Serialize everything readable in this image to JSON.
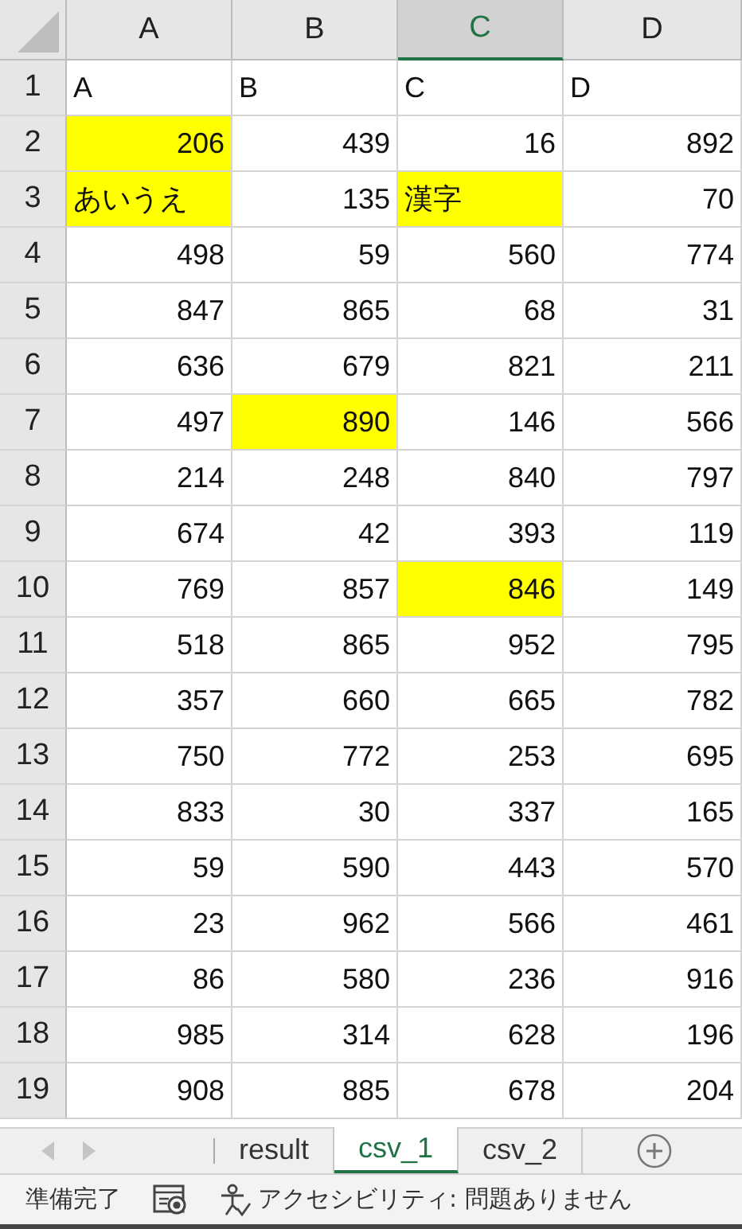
{
  "columns": [
    {
      "label": "A",
      "selected": false
    },
    {
      "label": "B",
      "selected": false
    },
    {
      "label": "C",
      "selected": true
    },
    {
      "label": "D",
      "selected": false
    }
  ],
  "rows": [
    {
      "header": "1",
      "cells": [
        {
          "kind": "text",
          "text": "A",
          "highlighted": false
        },
        {
          "kind": "text",
          "text": "B",
          "highlighted": false
        },
        {
          "kind": "text",
          "text": "C",
          "highlighted": false
        },
        {
          "kind": "text",
          "text": "D",
          "highlighted": false
        }
      ]
    },
    {
      "header": "2",
      "cells": [
        {
          "kind": "number",
          "text": "206",
          "highlighted": true
        },
        {
          "kind": "number",
          "text": "439",
          "highlighted": false
        },
        {
          "kind": "number",
          "text": "16",
          "highlighted": false
        },
        {
          "kind": "number",
          "text": "892",
          "highlighted": false
        }
      ]
    },
    {
      "header": "3",
      "cells": [
        {
          "kind": "text",
          "text": "あいうえ",
          "highlighted": true
        },
        {
          "kind": "number",
          "text": "135",
          "highlighted": false
        },
        {
          "kind": "text",
          "text": "漢字",
          "highlighted": true
        },
        {
          "kind": "number",
          "text": "70",
          "highlighted": false
        }
      ]
    },
    {
      "header": "4",
      "cells": [
        {
          "kind": "number",
          "text": "498",
          "highlighted": false
        },
        {
          "kind": "number",
          "text": "59",
          "highlighted": false
        },
        {
          "kind": "number",
          "text": "560",
          "highlighted": false
        },
        {
          "kind": "number",
          "text": "774",
          "highlighted": false
        }
      ]
    },
    {
      "header": "5",
      "cells": [
        {
          "kind": "number",
          "text": "847",
          "highlighted": false
        },
        {
          "kind": "number",
          "text": "865",
          "highlighted": false
        },
        {
          "kind": "number",
          "text": "68",
          "highlighted": false
        },
        {
          "kind": "number",
          "text": "31",
          "highlighted": false
        }
      ]
    },
    {
      "header": "6",
      "cells": [
        {
          "kind": "number",
          "text": "636",
          "highlighted": false
        },
        {
          "kind": "number",
          "text": "679",
          "highlighted": false
        },
        {
          "kind": "number",
          "text": "821",
          "highlighted": false
        },
        {
          "kind": "number",
          "text": "211",
          "highlighted": false
        }
      ]
    },
    {
      "header": "7",
      "cells": [
        {
          "kind": "number",
          "text": "497",
          "highlighted": false
        },
        {
          "kind": "number",
          "text": "890",
          "highlighted": true
        },
        {
          "kind": "number",
          "text": "146",
          "highlighted": false
        },
        {
          "kind": "number",
          "text": "566",
          "highlighted": false
        }
      ]
    },
    {
      "header": "8",
      "cells": [
        {
          "kind": "number",
          "text": "214",
          "highlighted": false
        },
        {
          "kind": "number",
          "text": "248",
          "highlighted": false
        },
        {
          "kind": "number",
          "text": "840",
          "highlighted": false
        },
        {
          "kind": "number",
          "text": "797",
          "highlighted": false
        }
      ]
    },
    {
      "header": "9",
      "cells": [
        {
          "kind": "number",
          "text": "674",
          "highlighted": false
        },
        {
          "kind": "number",
          "text": "42",
          "highlighted": false
        },
        {
          "kind": "number",
          "text": "393",
          "highlighted": false
        },
        {
          "kind": "number",
          "text": "119",
          "highlighted": false
        }
      ]
    },
    {
      "header": "10",
      "cells": [
        {
          "kind": "number",
          "text": "769",
          "highlighted": false
        },
        {
          "kind": "number",
          "text": "857",
          "highlighted": false
        },
        {
          "kind": "number",
          "text": "846",
          "highlighted": true
        },
        {
          "kind": "number",
          "text": "149",
          "highlighted": false
        }
      ]
    },
    {
      "header": "11",
      "cells": [
        {
          "kind": "number",
          "text": "518",
          "highlighted": false
        },
        {
          "kind": "number",
          "text": "865",
          "highlighted": false
        },
        {
          "kind": "number",
          "text": "952",
          "highlighted": false
        },
        {
          "kind": "number",
          "text": "795",
          "highlighted": false
        }
      ]
    },
    {
      "header": "12",
      "cells": [
        {
          "kind": "number",
          "text": "357",
          "highlighted": false
        },
        {
          "kind": "number",
          "text": "660",
          "highlighted": false
        },
        {
          "kind": "number",
          "text": "665",
          "highlighted": false
        },
        {
          "kind": "number",
          "text": "782",
          "highlighted": false
        }
      ]
    },
    {
      "header": "13",
      "cells": [
        {
          "kind": "number",
          "text": "750",
          "highlighted": false
        },
        {
          "kind": "number",
          "text": "772",
          "highlighted": false
        },
        {
          "kind": "number",
          "text": "253",
          "highlighted": false
        },
        {
          "kind": "number",
          "text": "695",
          "highlighted": false
        }
      ]
    },
    {
      "header": "14",
      "cells": [
        {
          "kind": "number",
          "text": "833",
          "highlighted": false
        },
        {
          "kind": "number",
          "text": "30",
          "highlighted": false
        },
        {
          "kind": "number",
          "text": "337",
          "highlighted": false
        },
        {
          "kind": "number",
          "text": "165",
          "highlighted": false
        }
      ]
    },
    {
      "header": "15",
      "cells": [
        {
          "kind": "number",
          "text": "59",
          "highlighted": false
        },
        {
          "kind": "number",
          "text": "590",
          "highlighted": false
        },
        {
          "kind": "number",
          "text": "443",
          "highlighted": false
        },
        {
          "kind": "number",
          "text": "570",
          "highlighted": false
        }
      ]
    },
    {
      "header": "16",
      "cells": [
        {
          "kind": "number",
          "text": "23",
          "highlighted": false
        },
        {
          "kind": "number",
          "text": "962",
          "highlighted": false
        },
        {
          "kind": "number",
          "text": "566",
          "highlighted": false
        },
        {
          "kind": "number",
          "text": "461",
          "highlighted": false
        }
      ]
    },
    {
      "header": "17",
      "cells": [
        {
          "kind": "number",
          "text": "86",
          "highlighted": false
        },
        {
          "kind": "number",
          "text": "580",
          "highlighted": false
        },
        {
          "kind": "number",
          "text": "236",
          "highlighted": false
        },
        {
          "kind": "number",
          "text": "916",
          "highlighted": false
        }
      ]
    },
    {
      "header": "18",
      "cells": [
        {
          "kind": "number",
          "text": "985",
          "highlighted": false
        },
        {
          "kind": "number",
          "text": "314",
          "highlighted": false
        },
        {
          "kind": "number",
          "text": "628",
          "highlighted": false
        },
        {
          "kind": "number",
          "text": "196",
          "highlighted": false
        }
      ]
    },
    {
      "header": "19",
      "cells": [
        {
          "kind": "number",
          "text": "908",
          "highlighted": false
        },
        {
          "kind": "number",
          "text": "885",
          "highlighted": false
        },
        {
          "kind": "number",
          "text": "678",
          "highlighted": false
        },
        {
          "kind": "number",
          "text": "204",
          "highlighted": false
        }
      ]
    }
  ],
  "sheet_tabs": [
    {
      "label": "result",
      "selected": false
    },
    {
      "label": "csv_1",
      "selected": true
    },
    {
      "label": "csv_2",
      "selected": false
    }
  ],
  "status_bar": {
    "ready": "準備完了",
    "accessibility": "アクセシビリティ: 問題ありません"
  }
}
